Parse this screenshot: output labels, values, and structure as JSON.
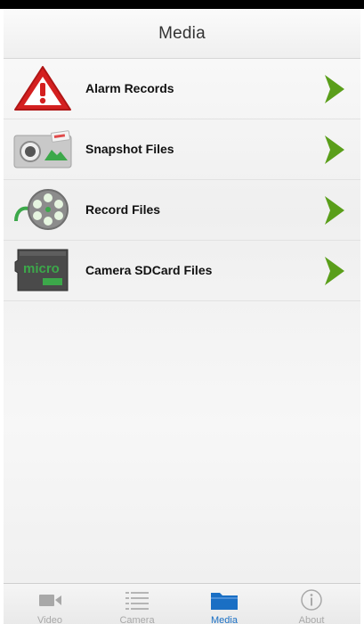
{
  "header": {
    "title": "Media"
  },
  "media_items": [
    {
      "label": "Alarm Records",
      "icon": "alarm-warning-icon"
    },
    {
      "label": "Snapshot Files",
      "icon": "snapshot-camera-icon"
    },
    {
      "label": "Record Files",
      "icon": "film-reel-icon"
    },
    {
      "label": "Camera SDCard Files",
      "icon": "micro-sd-card-icon"
    }
  ],
  "tabs": [
    {
      "label": "Video",
      "icon": "video-camera-icon",
      "active": false
    },
    {
      "label": "Camera",
      "icon": "list-icon",
      "active": false
    },
    {
      "label": "Media",
      "icon": "folder-icon",
      "active": true
    },
    {
      "label": "About",
      "icon": "info-icon",
      "active": false
    }
  ],
  "colors": {
    "chevron": "#5a9e1a",
    "active_tab": "#1a6fc4",
    "inactive_tab": "#a8a8a8",
    "warning_red": "#d42020"
  }
}
